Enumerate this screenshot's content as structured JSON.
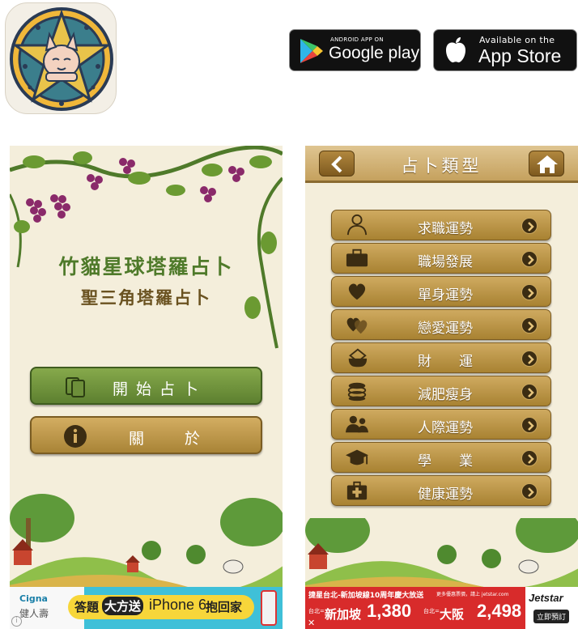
{
  "badges": {
    "google_play": {
      "small": "ANDROID APP ON",
      "big": "Google play"
    },
    "app_store": {
      "small": "Available on the",
      "big": "App Store"
    }
  },
  "home_screen": {
    "title": "竹貓星球塔羅占卜",
    "subtitle": "聖三角塔羅占卜",
    "start_label": "開始占卜",
    "about_label": "關　　於",
    "ad": {
      "brand": "Cigna",
      "brand_sub": "健人壽",
      "text_before": "答題",
      "highlight": "大方送",
      "product": "iPhone 6",
      "text_after": "抱回家"
    }
  },
  "category_screen": {
    "header_title": "占卜類型",
    "items": [
      {
        "label": "求職運勢",
        "icon": "job-seeker-icon"
      },
      {
        "label": "職場發展",
        "icon": "briefcase-icon"
      },
      {
        "label": "單身運勢",
        "icon": "heart-icon"
      },
      {
        "label": "戀愛運勢",
        "icon": "double-heart-icon"
      },
      {
        "label": "財　　運",
        "icon": "money-bag-icon"
      },
      {
        "label": "減肥瘦身",
        "icon": "coins-stack-icon"
      },
      {
        "label": "人際運勢",
        "icon": "people-icon"
      },
      {
        "label": "學　　業",
        "icon": "graduation-cap-icon"
      },
      {
        "label": "健康運勢",
        "icon": "first-aid-kit-icon"
      }
    ],
    "ad": {
      "headline": "捷星台北-新加坡線10周年慶大放送",
      "sub": "更多優惠票價，請上 jetstar.com",
      "route1_from": "台北=",
      "route1_to": "新加坡",
      "price1": "1,380",
      "route2_from": "台北=",
      "route2_to": "大阪",
      "price2": "2,498",
      "brand": "Jetstar",
      "cta": "立即預訂"
    }
  },
  "colors": {
    "green_button": "#6d8f3a",
    "gold_button": "#bb9646",
    "header_bg": "#d4b473",
    "background": "#f4eedb"
  }
}
